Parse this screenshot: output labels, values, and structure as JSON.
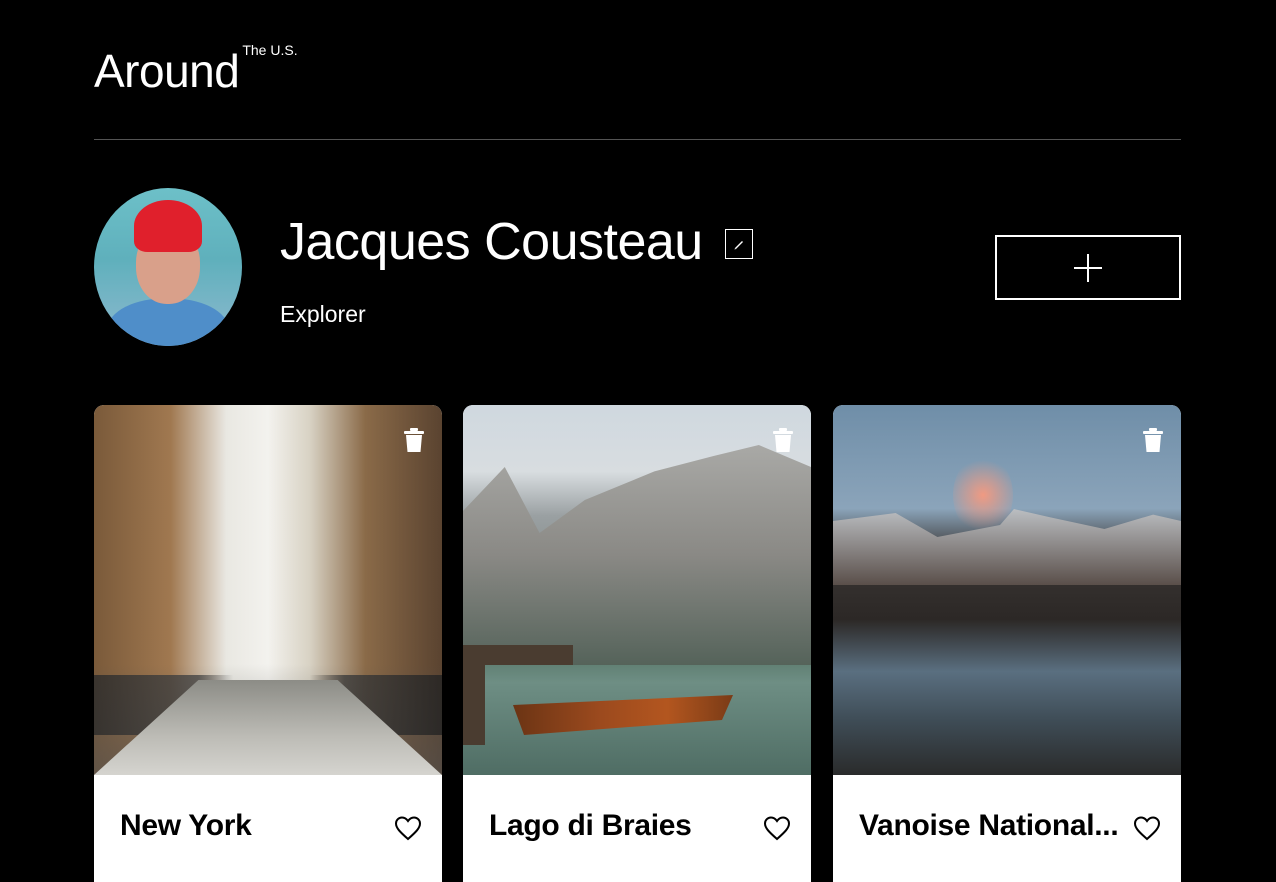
{
  "header": {
    "logo_main": "Around",
    "logo_sup": "The U.S."
  },
  "profile": {
    "name": "Jacques Cousteau",
    "job": "Explorer",
    "edit_icon": "pencil-icon",
    "add_icon": "plus-icon"
  },
  "cards": [
    {
      "title": "New York",
      "image": "new-york-street-image"
    },
    {
      "title": "Lago di Braies",
      "image": "lago-di-braies-image"
    },
    {
      "title": "Vanoise National...",
      "image": "vanoise-national-park-image"
    }
  ]
}
